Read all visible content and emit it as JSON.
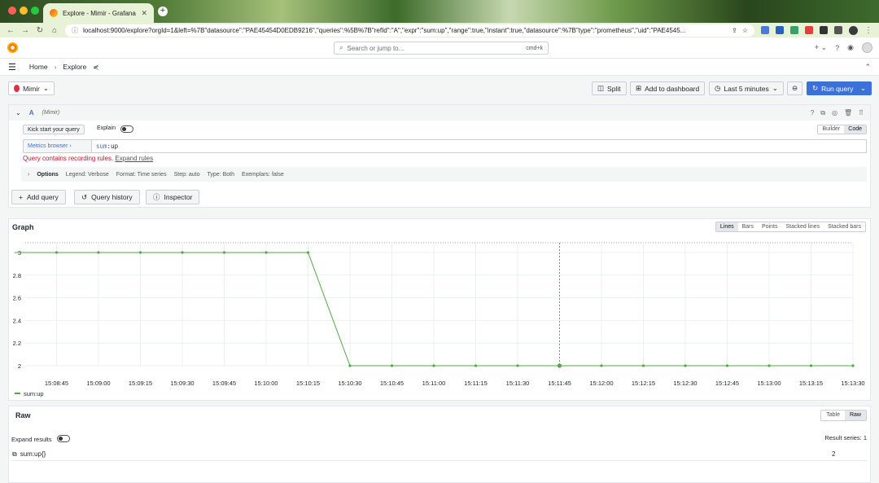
{
  "browser": {
    "tab_title": "Explore - Mimir - Grafana",
    "tab_close": "✕",
    "new_tab": "+",
    "url": "localhost:9000/explore?orgId=1&left=%7B\"datasource\":\"PAE45454D0EDB9216\",\"queries\":%5B%7B\"refId\":\"A\",\"expr\":\"sum:up\",\"range\":true,\"instant\":true,\"datasource\":%7B\"type\":\"prometheus\",\"uid\":\"PAE4545..."
  },
  "nav": {
    "search_placeholder": "Search or jump to...",
    "search_shortcut": "cmd+k",
    "plus_label": "+ ⌄",
    "breadcrumb": [
      "Home",
      "Explore"
    ]
  },
  "toolbar": {
    "datasource": "Mimir",
    "split": "Split",
    "add_dashboard": "Add to dashboard",
    "time_range": "Last 5 minutes",
    "run_query": "Run query"
  },
  "query": {
    "ref_id": "A",
    "datasource": "(Mimir)",
    "kick_start": "Kick start your query",
    "explain": "Explain",
    "mode_builder": "Builder",
    "mode_code": "Code",
    "metrics_browser": "Metrics browser ›",
    "expr_prefix": "sum",
    "expr_suffix": ":up",
    "warning": "Query contains recording rules.",
    "expand_rules": "Expand rules",
    "options_label": "Options",
    "options": [
      "Legend: Verbose",
      "Format: Time series",
      "Step: auto",
      "Type: Both",
      "Exemplars: false"
    ]
  },
  "actions": {
    "add_query": "Add query",
    "query_history": "Query history",
    "inspector": "Inspector"
  },
  "graph": {
    "title": "Graph",
    "modes": [
      "Lines",
      "Bars",
      "Points",
      "Stacked lines",
      "Stacked bars"
    ],
    "active_mode": "Lines",
    "series_color": "#56a64b"
  },
  "chart_data": {
    "type": "line",
    "title": "Graph",
    "xlabel": "",
    "ylabel": "",
    "x": [
      "15:08:30",
      "15:08:45",
      "15:09:00",
      "15:09:15",
      "15:09:30",
      "15:09:45",
      "15:10:00",
      "15:10:15",
      "15:10:30",
      "15:10:45",
      "15:11:00",
      "15:11:15",
      "15:11:30",
      "15:11:45",
      "15:12:00",
      "15:12:15",
      "15:12:30",
      "15:12:45",
      "15:13:00",
      "15:13:15",
      "15:13:30"
    ],
    "x_ticks": [
      "15:08:45",
      "15:09:00",
      "15:09:15",
      "15:09:30",
      "15:09:45",
      "15:10:00",
      "15:10:15",
      "15:10:30",
      "15:10:45",
      "15:11:00",
      "15:11:15",
      "15:11:30",
      "15:11:45",
      "15:12:00",
      "15:12:15",
      "15:12:30",
      "15:12:45",
      "15:13:00",
      "15:13:15",
      "15:13:30"
    ],
    "series": [
      {
        "name": "sum:up",
        "values": [
          3,
          3,
          3,
          3,
          3,
          3,
          3,
          3,
          2,
          2,
          2,
          2,
          2,
          2,
          2,
          2,
          2,
          2,
          2,
          2,
          2
        ]
      }
    ],
    "y_ticks": [
      "3",
      "2.8",
      "2.6",
      "2.4",
      "2.2",
      "2"
    ],
    "ylim": [
      2,
      3
    ],
    "legend": "bottom-left",
    "grid": true
  },
  "raw": {
    "title": "Raw",
    "mode_table": "Table",
    "mode_raw": "Raw",
    "expand": "Expand results",
    "result_series": "Result series: 1",
    "metric": "sum:up{}",
    "value": "2"
  }
}
